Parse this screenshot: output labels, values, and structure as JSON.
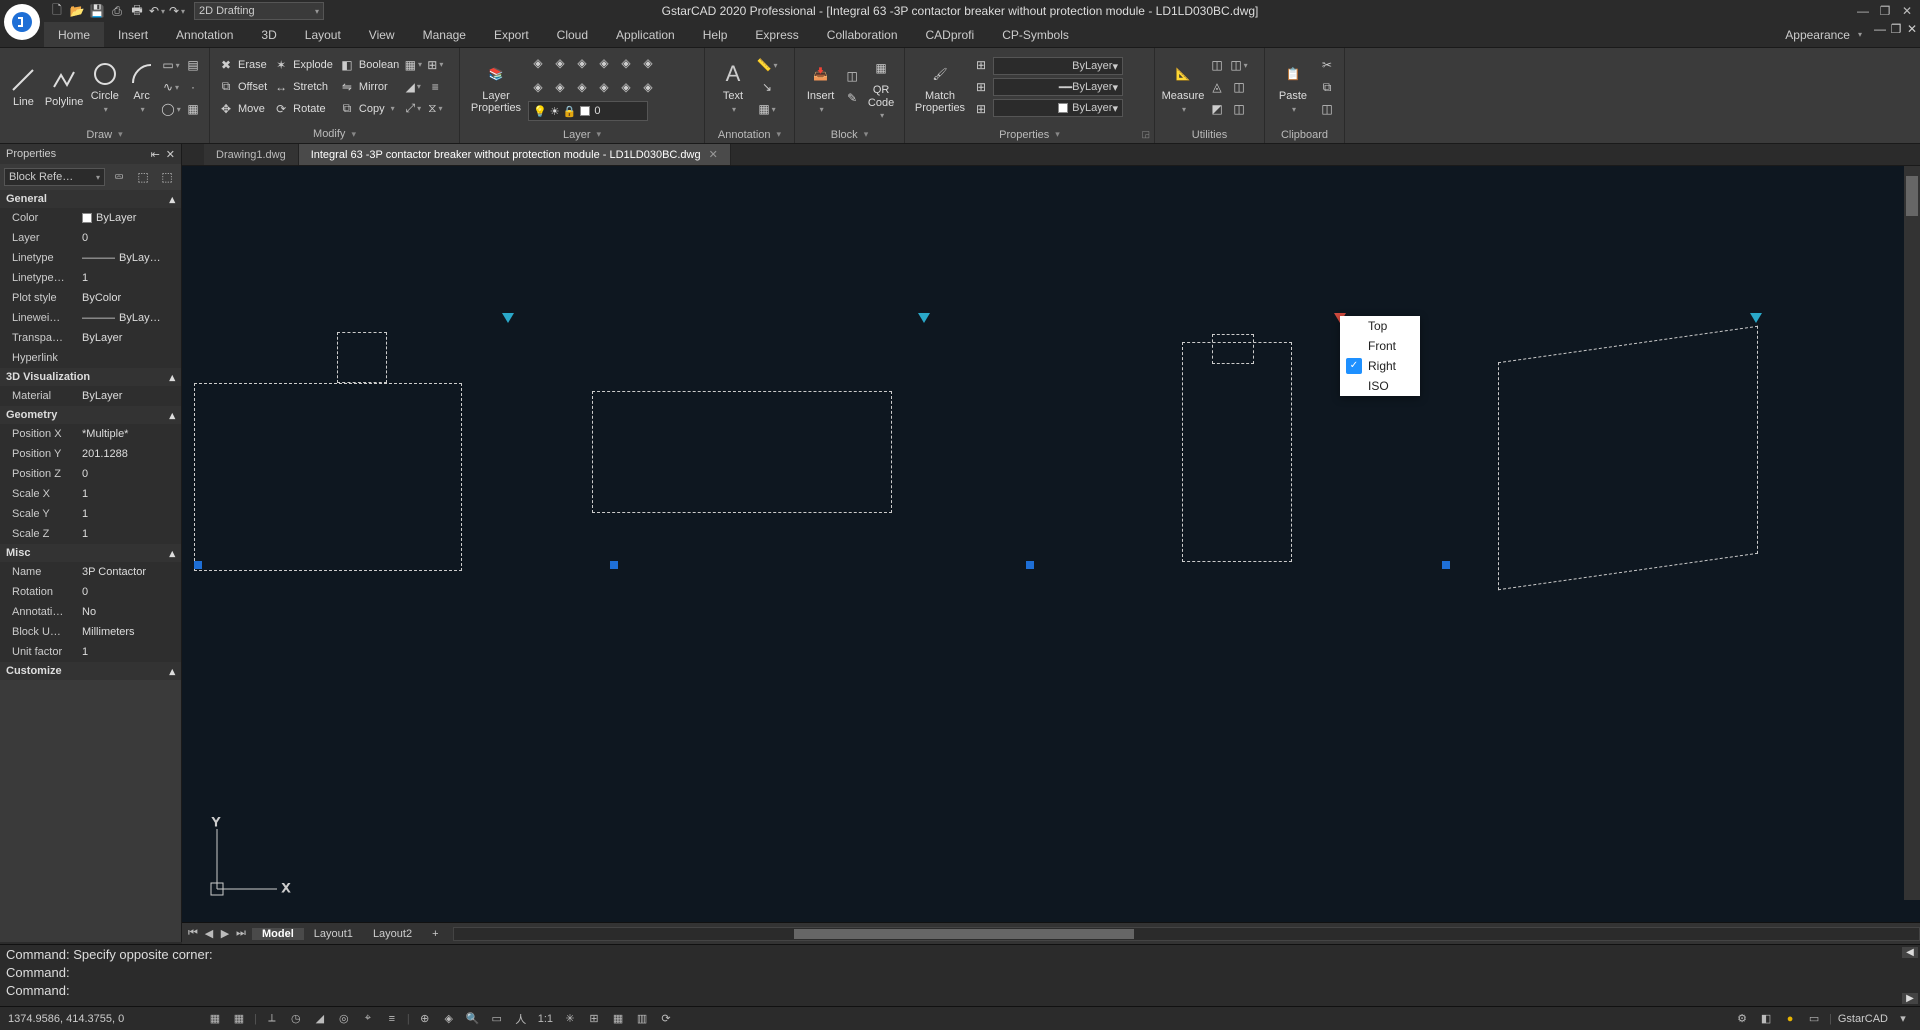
{
  "app": {
    "title": "GstarCAD 2020 Professional - [Integral 63 -3P contactor breaker without protection module - LD1LD030BC.dwg]",
    "workspace": "2D Drafting",
    "appearance_label": "Appearance"
  },
  "menubar": {
    "items": [
      "Home",
      "Insert",
      "Annotation",
      "3D",
      "Layout",
      "View",
      "Manage",
      "Export",
      "Cloud",
      "Application",
      "Help",
      "Express",
      "Collaboration",
      "CADprofi",
      "CP-Symbols"
    ],
    "active": "Home"
  },
  "ribbon": {
    "draw": {
      "title": "Draw",
      "line": "Line",
      "polyline": "Polyline",
      "circle": "Circle",
      "arc": "Arc"
    },
    "modify": {
      "title": "Modify",
      "erase": "Erase",
      "explode": "Explode",
      "boolean": "Boolean",
      "offset": "Offset",
      "stretch": "Stretch",
      "mirror": "Mirror",
      "move": "Move",
      "rotate": "Rotate",
      "copy": "Copy"
    },
    "layer": {
      "title": "Layer",
      "layer_props": "Layer\nProperties",
      "combo": "0"
    },
    "annotation": {
      "title": "Annotation",
      "text": "Text"
    },
    "block": {
      "title": "Block",
      "insert": "Insert",
      "qrcode": "QR\nCode"
    },
    "properties": {
      "title": "Properties",
      "match": "Match\nProperties",
      "bylayer": "ByLayer"
    },
    "utilities": {
      "title": "Utilities",
      "measure": "Measure"
    },
    "clipboard": {
      "title": "Clipboard",
      "paste": "Paste"
    }
  },
  "doctabs": {
    "items": [
      {
        "label": "Drawing1.dwg",
        "active": false
      },
      {
        "label": "Integral 63 -3P contactor breaker without protection module - LD1LD030BC.dwg",
        "active": true
      }
    ]
  },
  "properties_panel": {
    "title": "Properties",
    "selection": "Block Refe…",
    "general": {
      "title": "General",
      "color_k": "Color",
      "color_v": "ByLayer",
      "layer_k": "Layer",
      "layer_v": "0",
      "linetype_k": "Linetype",
      "linetype_v": "ByLay…",
      "ltscale_k": "Linetype…",
      "ltscale_v": "1",
      "plotstyle_k": "Plot style",
      "plotstyle_v": "ByColor",
      "linew_k": "Linewei…",
      "linew_v": "ByLay…",
      "transp_k": "Transpa…",
      "transp_v": "ByLayer",
      "hyper_k": "Hyperlink",
      "hyper_v": ""
    },
    "viz": {
      "title": "3D Visualization",
      "material_k": "Material",
      "material_v": "ByLayer"
    },
    "geometry": {
      "title": "Geometry",
      "px_k": "Position X",
      "px_v": "*Multiple*",
      "py_k": "Position Y",
      "py_v": "201.1288",
      "pz_k": "Position Z",
      "pz_v": "0",
      "sx_k": "Scale X",
      "sx_v": "1",
      "sy_k": "Scale Y",
      "sy_v": "1",
      "sz_k": "Scale Z",
      "sz_v": "1"
    },
    "misc": {
      "title": "Misc",
      "name_k": "Name",
      "name_v": "3P Contactor",
      "rot_k": "Rotation",
      "rot_v": "0",
      "anno_k": "Annotati…",
      "anno_v": "No",
      "unit_k": "Block U…",
      "unit_v": "Millimeters",
      "uf_k": "Unit factor",
      "uf_v": "1"
    },
    "customize": "Customize"
  },
  "context_menu": {
    "items": [
      "Top",
      "Front",
      "Right",
      "ISO"
    ],
    "checked": "Right"
  },
  "layout_tabs": {
    "model": "Model",
    "layouts": [
      "Layout1",
      "Layout2"
    ],
    "add": "+"
  },
  "command": {
    "line1": "Command: Specify opposite corner:",
    "line2": "Command:",
    "line3": "Command:"
  },
  "status": {
    "coords": "1374.9586, 414.3755, 0",
    "scale": "1:1",
    "brand": "GstarCAD"
  }
}
